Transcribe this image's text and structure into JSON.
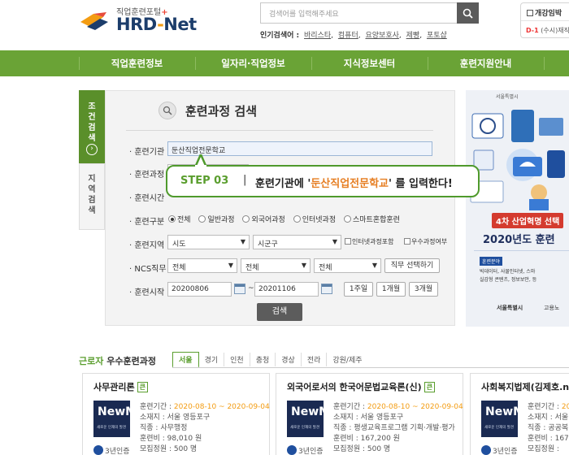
{
  "header": {
    "logo_sub": "직업훈련포털",
    "logo_plus": "+",
    "logo_main_a": "HRD",
    "logo_main_b": "-",
    "logo_main_c": "Net",
    "search_placeholder": "검색어를 입력해주세요",
    "popular_label": "인기검색어 :",
    "popular_keywords": [
      "바리스타",
      "컴퓨터",
      "요양보호사",
      "제빵",
      "포토샵"
    ],
    "side_box_title": "개강임박",
    "side_box_dday": "D-1",
    "side_box_text": "(수시)재직"
  },
  "nav": {
    "items": [
      "직업훈련정보",
      "일자리·직업정보",
      "지식정보센터",
      "훈련지원안내"
    ]
  },
  "tabs": {
    "condition": "조건검색",
    "region": "지역검색",
    "arrow": "›"
  },
  "form": {
    "title": "훈련과정 검색",
    "institution_label": "· 훈련기관",
    "institution_value": "둔산직업전문학교",
    "course_label": "· 훈련과정",
    "time_label": "· 훈련시간",
    "type_label": "· 훈련구분",
    "type_options": [
      "전체",
      "일반과정",
      "외국어과정",
      "인터넷과정",
      "스마트혼합훈련"
    ],
    "region_label": "· 훈련지역",
    "region_city": "시도",
    "region_district": "시군구",
    "chk_internet": "인터넷과정포함",
    "chk_excellent": "우수과정여부",
    "ncs_label": "· NCS직무",
    "ncs_1": "전체",
    "ncs_2": "전체",
    "ncs_3": "전체",
    "ncs_button": "직무 선택하기",
    "start_label": "· 훈련시작",
    "start_from": "20200806",
    "tilde": "~",
    "start_to": "20201106",
    "btn_week": "1주일",
    "btn_month": "1개월",
    "btn_3month": "3개월",
    "search_button": "검색"
  },
  "callout": {
    "step": "STEP 03",
    "sep": "|",
    "msg_a": "훈련기관에 '",
    "msg_hl": "둔산직업전문학교",
    "msg_b": "' 를 입력한다!"
  },
  "banner": {
    "header": "서울특별시",
    "title1": "4차 산업혁명 선택",
    "title2": "2020년도 훈련",
    "tag": "훈련분야",
    "line1": "빅데이터, 사물인터넷, 스마",
    "line2": "실감형 콘텐츠, 정보보안, 등",
    "footer_a": "서울특별시",
    "footer_b": "고용노"
  },
  "best": {
    "title_a": "근로자",
    "title_b": "우수훈련과정",
    "regions": [
      "서울",
      "경기",
      "인천",
      "충청",
      "경상",
      "전라",
      "강원/제주"
    ],
    "cards": [
      {
        "title": "사무관리론",
        "badge": "큰",
        "period_label": "훈련기간 :",
        "period": "2020-08-10 ~ 2020-09-04",
        "location": "소재지 : 서울 영등포구",
        "job": "직종 : 사무행정",
        "fee": "훈련비 : 98,010 원",
        "capacity": "모집정원 : 500 명",
        "cert": "3년인증",
        "thumb_title": "NewM",
        "thumb_sub": "새로운 인재의 발견"
      },
      {
        "title": "외국어로서의 한국어문법교육론(신)",
        "badge": "큰",
        "period_label": "훈련기간 :",
        "period": "2020-08-10 ~ 2020-09-04",
        "location": "소재지 : 서울 영등포구",
        "job": "직종 : 평생교육프로그램 기획·개발·평가",
        "fee": "훈련비 : 167,200 원",
        "capacity": "모집정원 : 500 명",
        "cert": "3년인증",
        "thumb_title": "NewM",
        "thumb_sub": "새로운 인재의 발견"
      },
      {
        "title": "사회복지법제(김제호.new",
        "badge": "",
        "period_label": "훈련기간 :",
        "period": "2020-",
        "location": "소재지 : 서울",
        "job": "직종 : 공공복",
        "fee": "훈련비 : 167",
        "capacity": "모집정원 :",
        "cert": "3년인증",
        "thumb_title": "NewM",
        "thumb_sub": "새로운 인재의 발견"
      }
    ]
  },
  "colors": {
    "nav_green": "#6aa336",
    "accent_green": "#5a9e2e",
    "highlight_orange": "#e67e22"
  }
}
